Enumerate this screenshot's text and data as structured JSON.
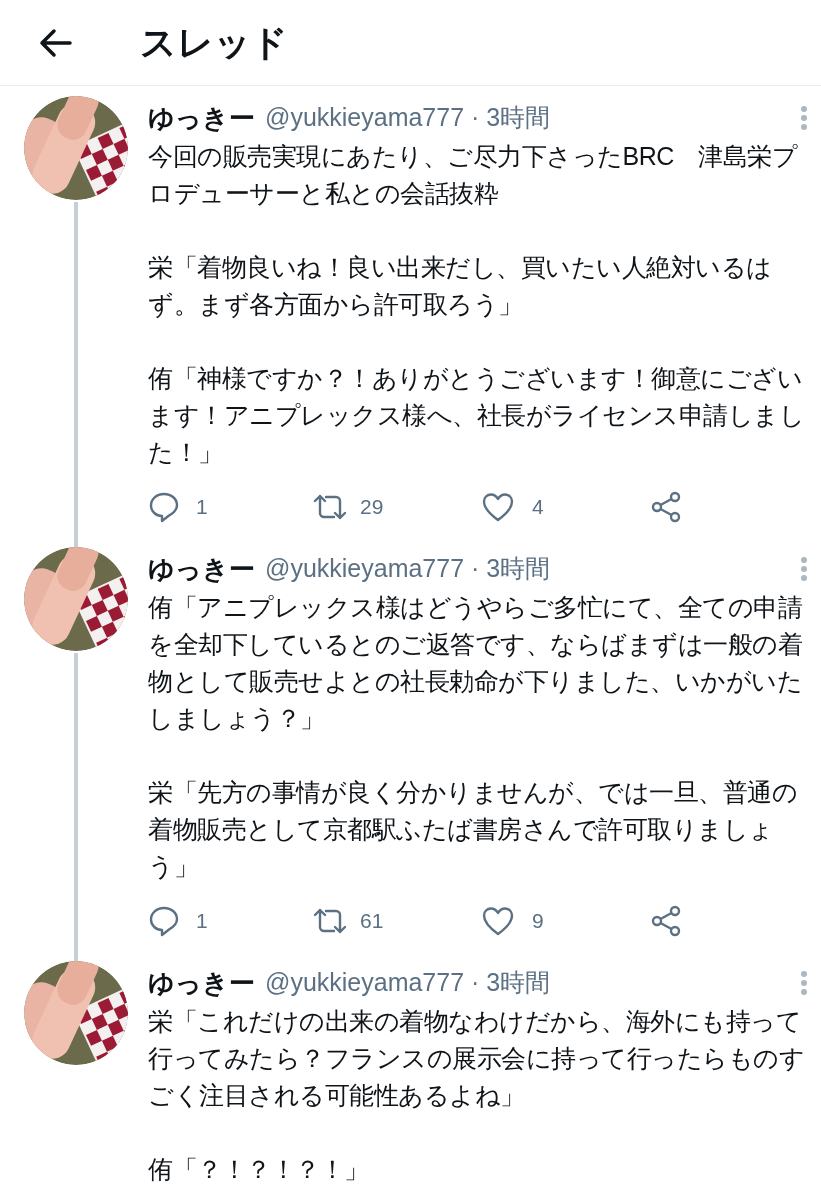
{
  "header": {
    "title": "スレッド"
  },
  "tweets": [
    {
      "name": "ゆっきー",
      "handle": "@yukkieyama777",
      "time": "· 3時間",
      "paragraphs": [
        "今回の販売実現にあたり、ご尽力下さったBRC　津島栄プロデューサーと私との会話抜粋",
        "栄「着物良いね！良い出来だし、買いたい人絶対いるはず。まず各方面から許可取ろう」",
        "侑「神様ですか？！ありがとうございます！御意にございます！アニプレックス様へ、社長がライセンス申請しました！」"
      ],
      "replies": "1",
      "retweets": "29",
      "likes": "4",
      "thread_continues": true
    },
    {
      "name": "ゆっきー",
      "handle": "@yukkieyama777",
      "time": "· 3時間",
      "paragraphs": [
        "侑「アニプレックス様はどうやらご多忙にて、全ての申請を全却下しているとのご返答です、ならばまずは一般の着物として販売せよとの社長勅命が下りました、いかがいたしましょう？」",
        "栄「先方の事情が良く分かりませんが、では一旦、普通の着物販売として京都駅ふたば書房さんで許可取りましょう」"
      ],
      "replies": "1",
      "retweets": "61",
      "likes": "9",
      "thread_continues": true
    },
    {
      "name": "ゆっきー",
      "handle": "@yukkieyama777",
      "time": "· 3時間",
      "paragraphs": [
        "栄「これだけの出来の着物なわけだから、海外にも持って行ってみたら？フランスの展示会に持って行ったらものすごく注目される可能性あるよね」",
        "侑「？！？！？！」"
      ],
      "thread_continues": false
    }
  ]
}
